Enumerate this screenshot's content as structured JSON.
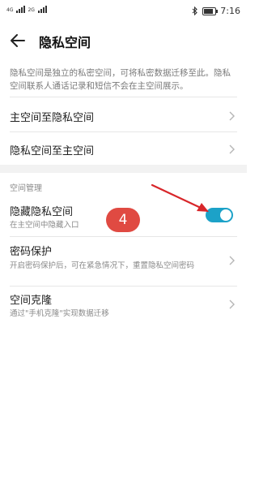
{
  "status_bar": {
    "network_1": "4G",
    "network_2": "2G",
    "time": "7:16",
    "battery_level": 0.8
  },
  "header": {
    "title": "隐私空间"
  },
  "intro": {
    "text": "隐私空间是独立的私密空间，可将私密数据迁移至此。隐私空间联系人通话记录和短信不会在主空间展示。"
  },
  "migration": {
    "items": [
      {
        "label": "主空间至隐私空间"
      },
      {
        "label": "隐私空间至主空间"
      }
    ]
  },
  "space_management": {
    "section_label": "空间管理",
    "hide": {
      "label": "隐藏隐私空间",
      "subtitle": "在主空间中隐藏入口",
      "enabled": true
    },
    "password": {
      "label": "密码保护",
      "subtitle": "开启密码保护后，可在紧急情况下，重置隐私空间密码"
    },
    "clone": {
      "label": "空间克隆",
      "subtitle": "通过\"手机克隆\"实现数据迁移"
    }
  },
  "annotation": {
    "step": "4",
    "badge_color": "#e04a42",
    "arrow_color": "#d8262a"
  },
  "colors": {
    "accent": "#1ca2c8"
  }
}
